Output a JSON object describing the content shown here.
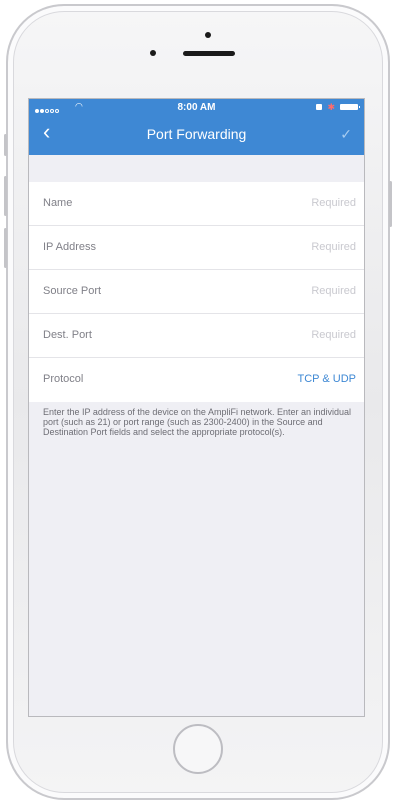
{
  "status_bar": {
    "time": "8:00 AM"
  },
  "nav": {
    "back_icon": "chevron-left-icon",
    "title": "Port Forwarding",
    "done_icon": "checkmark-icon"
  },
  "form": {
    "rows": [
      {
        "label": "Name",
        "value": "Required"
      },
      {
        "label": "IP Address",
        "value": "Required"
      },
      {
        "label": "Source Port",
        "value": "Required"
      },
      {
        "label": "Dest. Port",
        "value": "Required"
      },
      {
        "label": "Protocol",
        "value": "TCP & UDP"
      }
    ]
  },
  "help_text": "Enter the IP address of the device on the AmpliFi network. Enter an individual port (such as 21) or port range (such as 2300-2400) in the Source and Destination Port fields and select the appropriate protocol(s).",
  "colors": {
    "nav_bar": "#3e88d4",
    "protocol_value": "#3e88d4",
    "background": "#efeff4"
  }
}
